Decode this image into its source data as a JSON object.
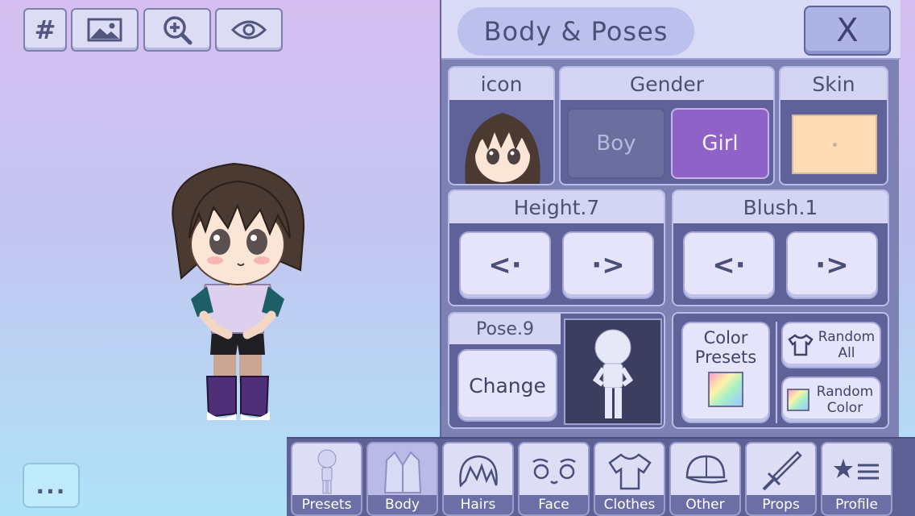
{
  "toolbar": {
    "hash_label": "#"
  },
  "more_button": {
    "label": "..."
  },
  "panel": {
    "title": "Body & Poses",
    "close_label": "X",
    "icon_section": {
      "title": "icon"
    },
    "gender": {
      "title": "Gender",
      "options": [
        "Boy",
        "Girl"
      ],
      "selected": "Girl"
    },
    "skin": {
      "title": "Skin",
      "color": "#ffdcb6"
    },
    "height": {
      "title": "Height.7"
    },
    "blush": {
      "title": "Blush.1"
    },
    "pose": {
      "title": "Pose.9",
      "change_label": "Change"
    },
    "color_presets": {
      "label": "Color Presets"
    },
    "random_all": {
      "label": "Random All"
    },
    "random_color": {
      "label": "Random Color"
    }
  },
  "tabs": [
    {
      "label": "Presets",
      "icon": "preset-figure-icon"
    },
    {
      "label": "Body",
      "icon": "body-jacket-icon",
      "active": true
    },
    {
      "label": "Hairs",
      "icon": "hair-icon"
    },
    {
      "label": "Face",
      "icon": "face-icon"
    },
    {
      "label": "Clothes",
      "icon": "shirt-icon"
    },
    {
      "label": "Other",
      "icon": "cap-icon"
    },
    {
      "label": "Props",
      "icon": "sword-icon"
    },
    {
      "label": "Profile",
      "icon": "star-list-icon"
    }
  ],
  "colors": {
    "accent_selected": "#8f62c7",
    "panel_bg": "#7d81b4",
    "tab_label_bg": "#6b6fa5"
  }
}
